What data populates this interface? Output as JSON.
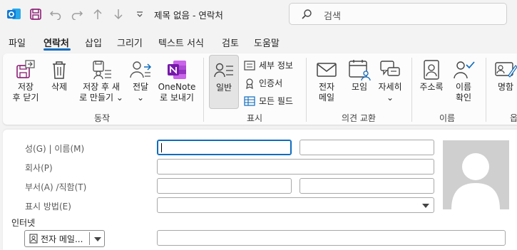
{
  "window": {
    "title": "제목 없음 - 연락처",
    "search_placeholder": "검색"
  },
  "menu_tabs": [
    "파일",
    "연락처",
    "삽입",
    "그리기",
    "텍스트 서식",
    "검토",
    "도움말"
  ],
  "active_tab": "연락처",
  "ribbon": {
    "save_close": [
      "저장",
      "후 닫기"
    ],
    "delete": "삭제",
    "save_new": [
      "저장 후 새",
      "로 만들기 ⌄"
    ],
    "forward": [
      "전달",
      "⌄"
    ],
    "onenote": [
      "OneNote",
      "로 보내기"
    ],
    "group_actions": "동작",
    "general": "일반",
    "details": "세부 정보",
    "certificates": "인증서",
    "all_fields": "모든 필드",
    "group_show": "표시",
    "email": [
      "전자",
      "메일"
    ],
    "meeting": "모임",
    "more": [
      "자세히",
      "⌄"
    ],
    "group_communicate": "의견 교환",
    "address_book": "주소록",
    "check_names": [
      "이름",
      "확인"
    ],
    "group_names": "이름",
    "business_card": "명함",
    "group_options_partial": "옵"
  },
  "form": {
    "full_name_label": "성(G)  | 이름(M)",
    "company_label": "회사(P)",
    "department_label": "부서(A)  /직함(T)",
    "file_as_label": "표시 방법(E)",
    "internet_label": "인터넷",
    "email_dropdown_label": "전자 메일...",
    "last_name_value": "",
    "first_name_value": "",
    "company_value": "",
    "department_value": "",
    "job_title_value": "",
    "file_as_value": "",
    "email_value": ""
  },
  "colors": {
    "accent": "#0f6cbd",
    "outlook_blue": "#0f78d4",
    "onenote_purple": "#7719aa",
    "save_icon_purple": "#8b1d74"
  }
}
